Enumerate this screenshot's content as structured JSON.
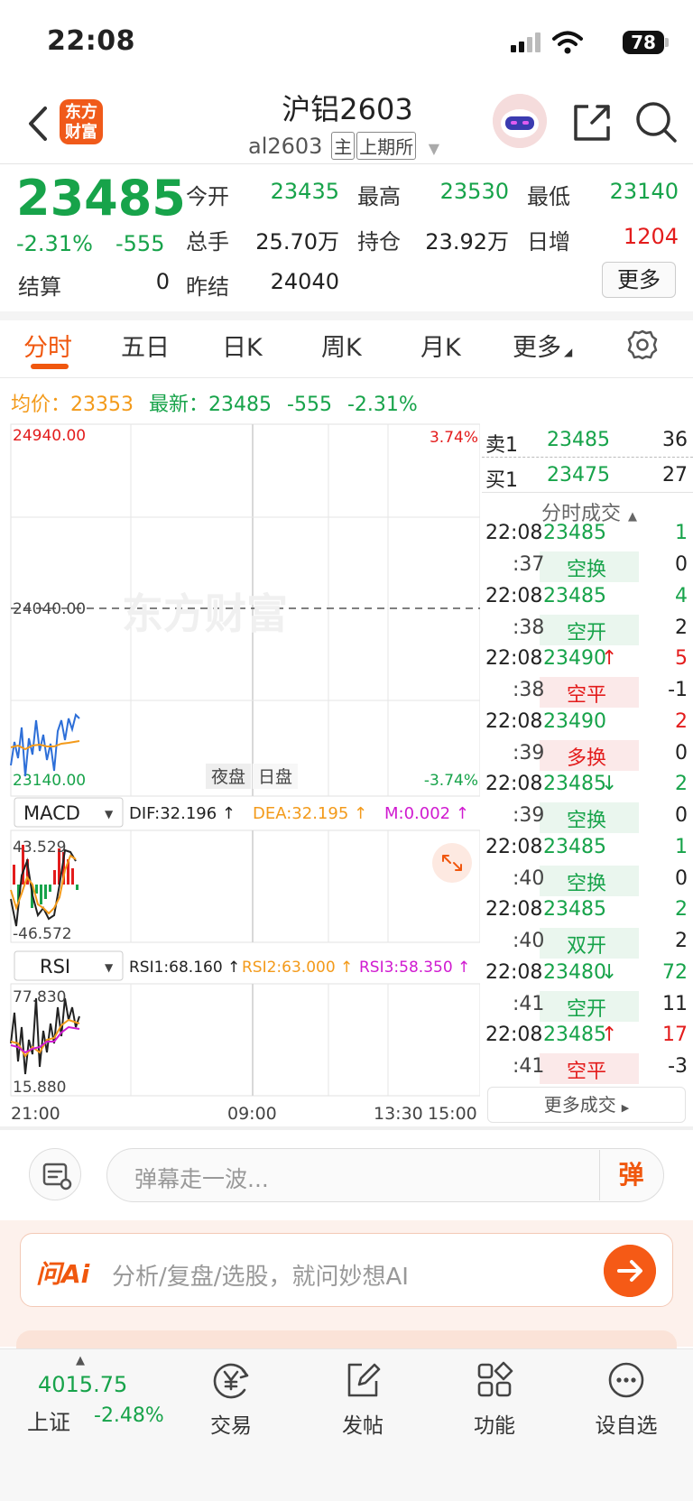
{
  "status_bar": {
    "time": "22:08",
    "battery": "78"
  },
  "header": {
    "logo": "东方财富",
    "title": "沪铝2603",
    "code": "al2603",
    "tag_main": "主",
    "tag_exchange": "上期所"
  },
  "quote": {
    "price": "23485",
    "change_pct": "-2.31%",
    "change": "-555",
    "fields": [
      {
        "label": "今开",
        "value": "23435",
        "color": "#17a34a"
      },
      {
        "label": "最高",
        "value": "23530",
        "color": "#17a34a"
      },
      {
        "label": "最低",
        "value": "23140",
        "color": "#17a34a"
      },
      {
        "label": "总手",
        "value": "25.70万",
        "color": "#222222"
      },
      {
        "label": "持仓",
        "value": "23.92万",
        "color": "#222222"
      },
      {
        "label": "日增",
        "value": "1204",
        "color": "#e31c1c"
      },
      {
        "label": "结算",
        "value": "0",
        "color": "#222222"
      },
      {
        "label": "昨结",
        "value": "24040",
        "color": "#222222"
      }
    ],
    "more_button": "更多"
  },
  "tabs": [
    "分时",
    "五日",
    "日K",
    "周K",
    "月K",
    "更多"
  ],
  "info_line": {
    "avg_label": "均价：",
    "avg_value": "23353",
    "latest_label": "最新：",
    "latest_value": "23485",
    "latest_change": "-555",
    "latest_pct": "-2.31%"
  },
  "chart": {
    "y_top": "24940.00",
    "y_mid": "24040.00",
    "y_bottom": "23140.00",
    "pct_top": "3.74%",
    "pct_bottom": "-3.74%",
    "session_night": "夜盘",
    "session_day": "日盘",
    "watermark": "东方财富",
    "macd": {
      "name": "MACD",
      "dif": "DIF:32.196 ↑",
      "dea": "DEA:32.195 ↑",
      "m": "M:0.002 ↑",
      "top": "43.529",
      "bottom": "-46.572"
    },
    "rsi": {
      "name": "RSI",
      "rsi1": "RSI1:68.160 ↑",
      "rsi2": "RSI2:63.000 ↑",
      "rsi3": "RSI3:58.350 ↑",
      "top": "77.830",
      "bottom": "15.880"
    },
    "x_labels": [
      "21:00",
      "09:00",
      "13:30",
      "15:00"
    ]
  },
  "order_book": {
    "sell": {
      "label": "卖1",
      "price": "23485",
      "vol": "36"
    },
    "buy": {
      "label": "买1",
      "price": "23475",
      "vol": "27"
    }
  },
  "trades_header": "分时成交",
  "trades": [
    {
      "time": "22:08",
      "price": "23485",
      "arrow": "",
      "vol": "1",
      "sub_time": ":37",
      "type": "空换",
      "sub_vol": "0",
      "type_color": "#17a34a",
      "vol_color": "#17a34a",
      "sub_bg": "#eaf6ee"
    },
    {
      "time": "22:08",
      "price": "23485",
      "arrow": "",
      "vol": "4",
      "sub_time": ":38",
      "type": "空开",
      "sub_vol": "2",
      "type_color": "#17a34a",
      "vol_color": "#17a34a",
      "sub_bg": "#eaf6ee"
    },
    {
      "time": "22:08",
      "price": "23490",
      "arrow": "↑",
      "vol": "5",
      "sub_time": ":38",
      "type": "空平",
      "sub_vol": "-1",
      "type_color": "#e31c1c",
      "vol_color": "#e31c1c",
      "sub_bg": "#fbe9e9"
    },
    {
      "time": "22:08",
      "price": "23490",
      "arrow": "",
      "vol": "2",
      "sub_time": ":39",
      "type": "多换",
      "sub_vol": "0",
      "type_color": "#e31c1c",
      "vol_color": "#e31c1c",
      "sub_bg": "#fbe9e9"
    },
    {
      "time": "22:08",
      "price": "23485",
      "arrow": "↓",
      "vol": "2",
      "sub_time": ":39",
      "type": "空换",
      "sub_vol": "0",
      "type_color": "#17a34a",
      "vol_color": "#17a34a",
      "sub_bg": "#eaf6ee"
    },
    {
      "time": "22:08",
      "price": "23485",
      "arrow": "",
      "vol": "1",
      "sub_time": ":40",
      "type": "空换",
      "sub_vol": "0",
      "type_color": "#17a34a",
      "vol_color": "#17a34a",
      "sub_bg": "#eaf6ee"
    },
    {
      "time": "22:08",
      "price": "23485",
      "arrow": "",
      "vol": "2",
      "sub_time": ":40",
      "type": "双开",
      "sub_vol": "2",
      "type_color": "#17a34a",
      "vol_color": "#17a34a",
      "sub_bg": "#eaf6ee"
    },
    {
      "time": "22:08",
      "price": "23480",
      "arrow": "↓",
      "vol": "72",
      "sub_time": ":41",
      "type": "空开",
      "sub_vol": "11",
      "type_color": "#17a34a",
      "vol_color": "#17a34a",
      "sub_bg": "#eaf6ee"
    },
    {
      "time": "22:08",
      "price": "23485",
      "arrow": "↑",
      "vol": "17",
      "sub_time": ":41",
      "type": "空平",
      "sub_vol": "-3",
      "type_color": "#e31c1c",
      "vol_color": "#e31c1c",
      "sub_bg": "#fbe9e9"
    }
  ],
  "more_trades": "更多成交",
  "danmu": {
    "placeholder": "弹幕走一波...",
    "button": "弹"
  },
  "ai": {
    "logo": "问Ai",
    "placeholder": "分析/复盘/选股，就问妙想AI"
  },
  "tabbar": {
    "index_value": "4015.75",
    "index_name": "上证",
    "index_pct": "-2.48%",
    "items": [
      {
        "label": "交易",
        "icon": "yen-exchange-icon"
      },
      {
        "label": "发帖",
        "icon": "edit-post-icon"
      },
      {
        "label": "功能",
        "icon": "grid-function-icon"
      },
      {
        "label": "设自选",
        "icon": "more-dots-icon"
      }
    ]
  },
  "colors": {
    "up": "#e31c1c",
    "down": "#17a34a",
    "accent": "#f0570e",
    "avg_line": "#f39a1a"
  }
}
